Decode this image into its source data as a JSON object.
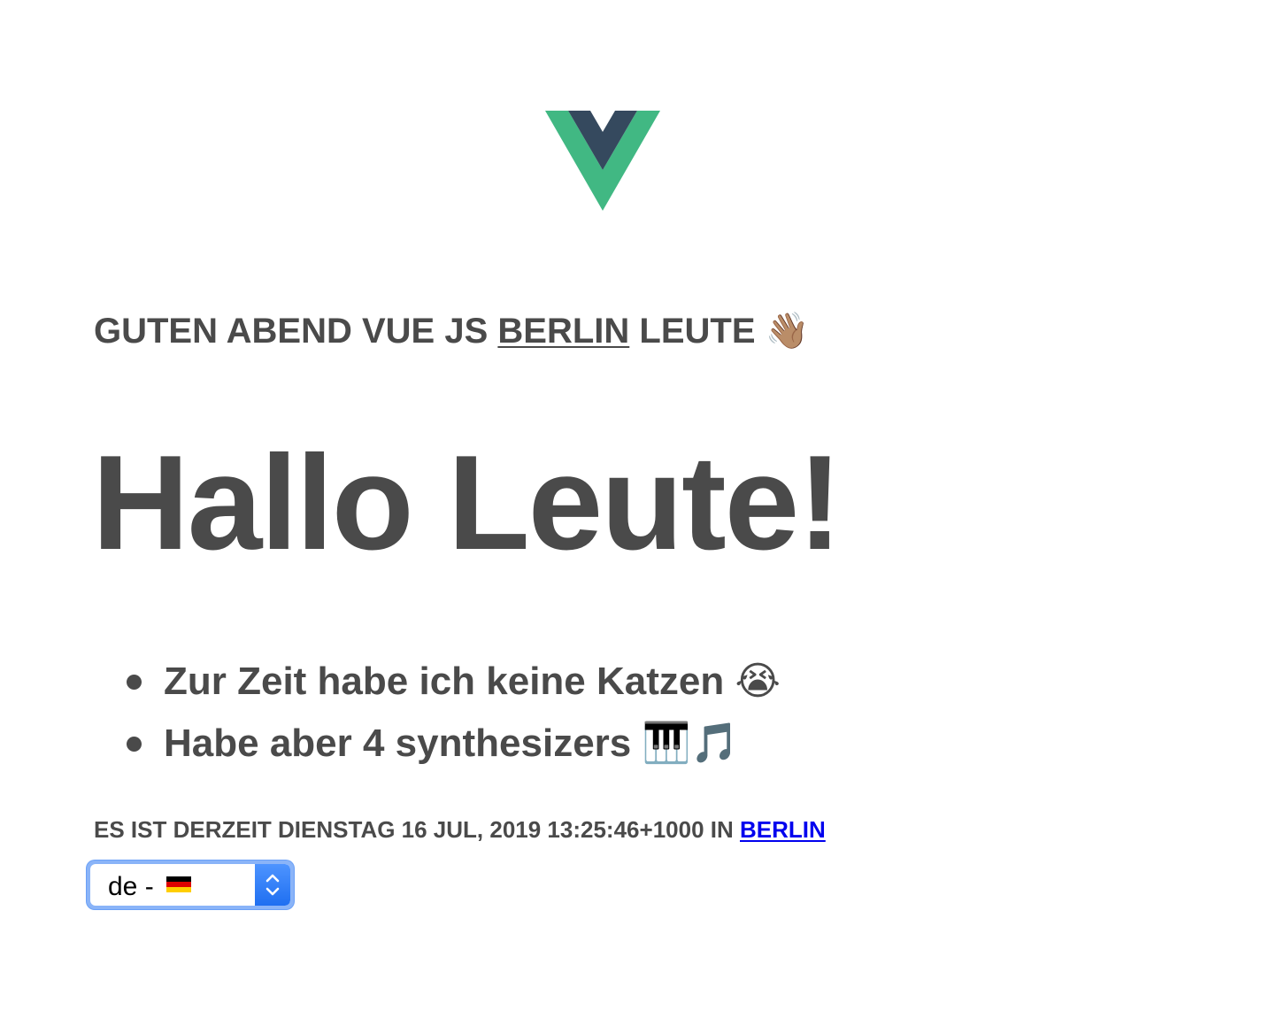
{
  "logo": {
    "icon": "vue-logo-icon",
    "colors": {
      "outer": "#41b883",
      "inner": "#35495e"
    }
  },
  "greeting": {
    "prefix": "GUTEN ABEND VUE JS",
    "city": "BERLIN",
    "suffix": "LEUTE",
    "emoji": "👋🏽"
  },
  "title": "Hallo Leute!",
  "facts": [
    {
      "text": "Zur Zeit habe ich keine Katzen",
      "emoji": "😭"
    },
    {
      "text": "Habe aber 4 synthesizers",
      "emoji": "🎹🎵"
    }
  ],
  "datetime": {
    "text": "ES IST DERZEIT DIENSTAG 16 JUL, 2019 13:25:46+1000 IN",
    "city_link": "BERLIN"
  },
  "language_select": {
    "value": "de -",
    "flag_icon": "germany-flag-icon",
    "flag_colors": [
      "#000000",
      "#dd0000",
      "#ffce00"
    ]
  },
  "colors": {
    "text": "#4a4a4a",
    "link": "#0000ee",
    "focus_ring": "#8ab4f8",
    "select_button": "#1f6ff1"
  }
}
